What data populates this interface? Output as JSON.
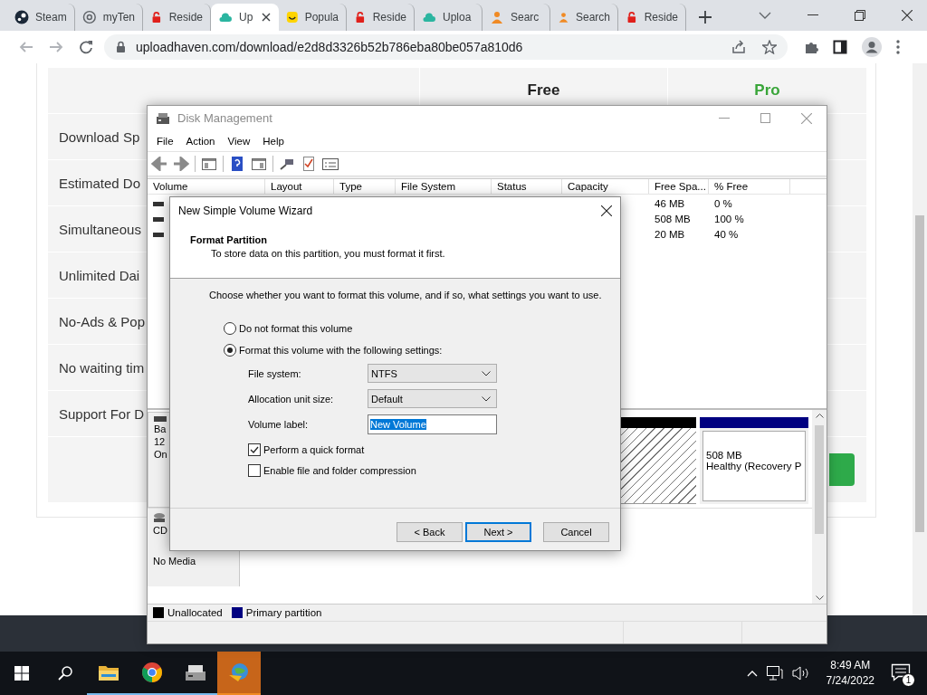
{
  "browser": {
    "tabs": [
      {
        "label": "Steam",
        "kind": "steam",
        "selected": false
      },
      {
        "label": "myTen",
        "kind": "at",
        "selected": false
      },
      {
        "label": "Reside",
        "kind": "lock",
        "selected": false
      },
      {
        "label": "Up",
        "kind": "cloud",
        "selected": true
      },
      {
        "label": "Popula",
        "kind": "smile",
        "selected": false
      },
      {
        "label": "Reside",
        "kind": "lock",
        "selected": false
      },
      {
        "label": "Uploa",
        "kind": "cloud",
        "selected": false
      },
      {
        "label": "Searc",
        "kind": "person",
        "selected": false
      },
      {
        "label": "Search",
        "kind": "person",
        "selected": false
      },
      {
        "label": "Reside",
        "kind": "lock",
        "selected": false
      }
    ],
    "url": "uploadhaven.com/download/e2d8d3326b52b786eba80be057a810d6"
  },
  "web_page": {
    "columns": [
      {
        "label": "Free",
        "color": "#222222"
      },
      {
        "label": "Pro",
        "color": "#3aa63a"
      }
    ],
    "features": [
      "Download Sp",
      "Estimated Do",
      "Simultaneous",
      "Unlimited Dai",
      "No-Ads & Pop",
      "No waiting tim",
      "Support For D"
    ]
  },
  "disk_management": {
    "title": "Disk Management",
    "menu": [
      "File",
      "Action",
      "View",
      "Help"
    ],
    "columns": [
      "Volume",
      "Layout",
      "Type",
      "File System",
      "Status",
      "Capacity",
      "Free Spa...",
      "% Free"
    ],
    "volumes": [
      {
        "free_space": "46 MB",
        "percent_free": "0 %"
      },
      {
        "free_space": "508 MB",
        "percent_free": "100 %"
      },
      {
        "free_space": "20 MB",
        "percent_free": "40 %"
      }
    ],
    "disks": [
      {
        "kind": "basic",
        "lines": [
          "Ba",
          "12",
          "On"
        ],
        "partitions": [
          {
            "kind": "unallocated"
          },
          {
            "kind": "primary",
            "size": "508 MB",
            "status": "Healthy (Recovery P"
          }
        ]
      },
      {
        "kind": "cdrom",
        "lines": [
          "CD",
          "No Media"
        ]
      }
    ],
    "legend": [
      {
        "label": "Unallocated",
        "color": "#000000"
      },
      {
        "label": "Primary partition",
        "color": "#000080"
      }
    ]
  },
  "wizard": {
    "title": "New Simple Volume Wizard",
    "heading": "Format Partition",
    "subheading": "To store data on this partition, you must format it first.",
    "prompt": "Choose whether you want to format this volume, and if so, what settings you want to use.",
    "options": [
      {
        "label": "Do not format this volume",
        "selected": false
      },
      {
        "label": "Format this volume with the following settings:",
        "selected": true
      }
    ],
    "fields": [
      {
        "label": "File system:",
        "kind": "dropdown",
        "value": "NTFS"
      },
      {
        "label": "Allocation unit size:",
        "kind": "dropdown",
        "value": "Default"
      },
      {
        "label": "Volume label:",
        "kind": "text",
        "value": "New Volume"
      }
    ],
    "checkboxes": [
      {
        "label": "Perform a quick format",
        "checked": true
      },
      {
        "label": "Enable file and folder compression",
        "checked": false
      }
    ],
    "buttons": [
      {
        "label": "< Back",
        "default": false
      },
      {
        "label": "Next >",
        "default": true
      },
      {
        "label": "Cancel",
        "default": false
      }
    ]
  },
  "taskbar": {
    "apps": [
      {
        "kind": "explorer",
        "running": true,
        "selected": false
      },
      {
        "kind": "chrome",
        "running": true,
        "selected": false
      },
      {
        "kind": "disk",
        "running": true,
        "selected": false
      },
      {
        "kind": "downloader",
        "running": true,
        "selected": true
      }
    ],
    "time": "8:49 AM",
    "date": "7/24/2022",
    "notifications": "1"
  }
}
